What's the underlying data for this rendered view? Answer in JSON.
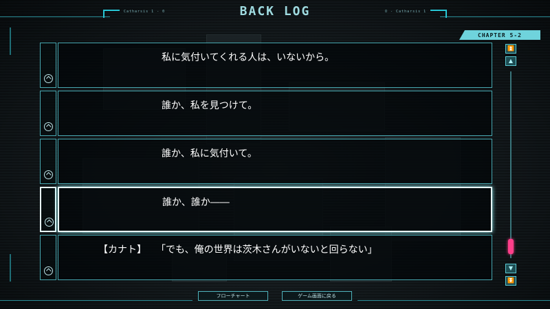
{
  "header": {
    "title": "BACK LOG",
    "left_tag": "Catharsis 1 - 0",
    "right_tag": "O - Catharsis 1"
  },
  "chapter": {
    "label": "CHAPTER  5-2"
  },
  "entries": [
    {
      "speaker": "",
      "text": "私に気付いてくれる人は、いないから。"
    },
    {
      "speaker": "",
      "text": "誰か、私を見つけて。"
    },
    {
      "speaker": "",
      "text": "誰か、私に気付いて。"
    },
    {
      "speaker": "",
      "text": "誰か、誰か――"
    },
    {
      "speaker": "【カナト】",
      "text": "「でも、俺の世界は茨木さんがいないと回らない」"
    }
  ],
  "selected_entry": 4,
  "scrollbar": {
    "position": 0.9
  },
  "footer": {
    "flowchart_label": "フローチャート",
    "return_label": "ゲーム画面に戻る"
  },
  "colors": {
    "accent": "#28c6d4",
    "thumb": "#ff3f8a"
  }
}
